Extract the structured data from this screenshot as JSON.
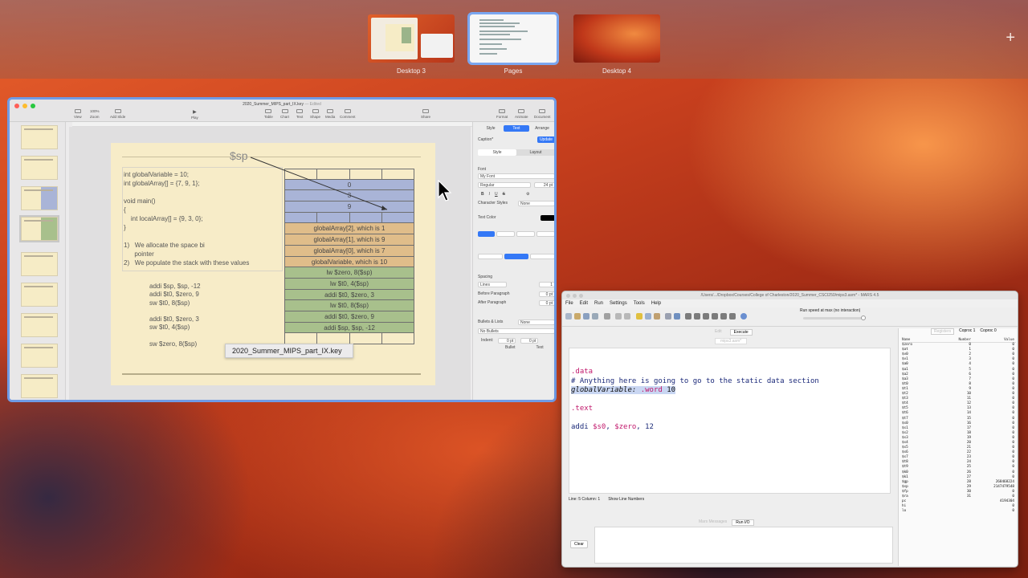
{
  "mission_control": {
    "spaces": [
      {
        "label": "Desktop 3",
        "active": false
      },
      {
        "label": "Pages",
        "active": true
      },
      {
        "label": "Desktop 4",
        "active": false
      }
    ],
    "add_space_icon": "plus-icon"
  },
  "keynote": {
    "title": "2020_Summer_MIPS_part_IX.key",
    "title_suffix": "— Edited",
    "toolbar": [
      "View",
      "Zoom",
      "Add Slide",
      "Play",
      "Table",
      "Chart",
      "Text",
      "Shape",
      "Media",
      "Comment",
      "Share",
      "Format",
      "Animate",
      "Document"
    ],
    "zoom": "100%",
    "tooltip": "2020_Summer_MIPS_part_IX.key",
    "slide": {
      "sp_label": "$sp",
      "code": "int globalVariable = 10;\nint globalArray[] = {7, 9, 1};\n\nvoid main()\n{\n    int localArray[] = {9, 3, 0};\n}",
      "bullets": "1)   We allocate the space bi\n      pointer\n2)   We populate the stack with these values",
      "mips": "addi $sp, $sp, -12\naddi $t0, $zero, 9\nsw $t0, 8($sp)\n\naddi $t0, $zero, 3\nsw $t0, 4($sp)\n\nsw $zero, 8($sp)",
      "stack_rows": [
        {
          "text": "",
          "color": "empty",
          "cells": true
        },
        {
          "text": "0",
          "color": "blue"
        },
        {
          "text": "3",
          "color": "blue"
        },
        {
          "text": "9",
          "color": "blue"
        },
        {
          "text": "",
          "color": "blue",
          "cells": true
        },
        {
          "text": "globalArray[2], which is 1",
          "color": "tan"
        },
        {
          "text": "globalArray[1], which is 9",
          "color": "tan"
        },
        {
          "text": "globalArray[0], which is 7",
          "color": "tan"
        },
        {
          "text": "globalVariable, which is 10",
          "color": "tan"
        },
        {
          "text": "lw $zero, 8($sp)",
          "color": "green"
        },
        {
          "text": "lw $t0, 4($sp)",
          "color": "green"
        },
        {
          "text": "addi $t0, $zero, 3",
          "color": "green"
        },
        {
          "text": "lw $t0, 8($sp)",
          "color": "green"
        },
        {
          "text": "addi $t0, $zero, 9",
          "color": "green"
        },
        {
          "text": "addi $sp, $sp, -12",
          "color": "green"
        },
        {
          "text": "",
          "color": "empty",
          "cells": true
        }
      ]
    },
    "inspector": {
      "tabs": [
        "Style",
        "Text",
        "Arrange"
      ],
      "active_tab": "Text",
      "paragraph_style": "Caption*",
      "update_label": "Update",
      "subtabs": [
        "Style",
        "Layout"
      ],
      "font_label": "Font",
      "font_name": "My Font",
      "font_weight": "Regular",
      "font_size": "24 pt",
      "char_styles_label": "Character Styles",
      "char_styles_value": "None",
      "text_color_label": "Text Color",
      "spacing_label": "Spacing",
      "spacing_value": "Lines",
      "spacing_num": "1",
      "before_para_label": "Before Paragraph",
      "before_para_value": "0 pt",
      "after_para_label": "After Paragraph",
      "after_para_value": "0 pt",
      "bullets_label": "Bullets & Lists",
      "bullets_value": "None",
      "no_bullets": "No Bullets",
      "indent_label": "Indent:",
      "indent_bullet": "Bullet",
      "indent_text": "Text"
    },
    "colors": {
      "border": "#6f9be6"
    }
  },
  "mars": {
    "title": "/Users/.../Dropbox/Courses/College of Charleston/2020_Summer_CSCI250/mips3.asm* - MARS 4.5",
    "menu": [
      "File",
      "Edit",
      "Run",
      "Settings",
      "Tools",
      "Help"
    ],
    "speed_label": "Run speed at max (no interaction)",
    "edit_tabs": [
      "Edit",
      "Execute"
    ],
    "active_edit_tab": "Execute",
    "file_tab": "mips3.asm*",
    "code_lines": [
      {
        "parts": [
          {
            "t": ".data",
            "c": "asm-dir"
          }
        ]
      },
      {
        "parts": [
          {
            "t": "# Anything here is going to go to the static data section",
            "c": "asm-cmt"
          }
        ]
      },
      {
        "parts": [
          {
            "t": "globalVariable:",
            "c": "asm-lbl"
          },
          {
            "t": " .word",
            "c": "asm-dir asm-lblhl"
          },
          {
            "t": " 10",
            "c": "asm-num asm-lblhl"
          }
        ]
      },
      {
        "parts": [
          {
            "t": " ",
            "c": ""
          }
        ]
      },
      {
        "parts": [
          {
            "t": ".text",
            "c": "asm-dir"
          }
        ]
      },
      {
        "parts": [
          {
            "t": " ",
            "c": ""
          }
        ]
      },
      {
        "parts": [
          {
            "t": "addi ",
            "c": "asm-ins"
          },
          {
            "t": "$s0",
            "c": "asm-reg"
          },
          {
            "t": ", ",
            "c": "asm-ins"
          },
          {
            "t": "$zero",
            "c": "asm-reg"
          },
          {
            "t": ", 12",
            "c": "asm-ins"
          }
        ]
      }
    ],
    "status_line": "Line: 5 Column: 1",
    "show_line_numbers": "Show Line Numbers",
    "io_tabs": [
      "Mars Messages",
      "Run I/O"
    ],
    "active_io_tab": "Run I/O",
    "clear_label": "Clear",
    "reg_tabs": [
      "Registers",
      "Coproc 1",
      "Coproc 0"
    ],
    "reg_header": [
      "Name",
      "Number",
      "Value"
    ],
    "registers": [
      [
        "$zero",
        "0",
        "0"
      ],
      [
        "$at",
        "1",
        "0"
      ],
      [
        "$v0",
        "2",
        "0"
      ],
      [
        "$v1",
        "3",
        "0"
      ],
      [
        "$a0",
        "4",
        "0"
      ],
      [
        "$a1",
        "5",
        "0"
      ],
      [
        "$a2",
        "6",
        "0"
      ],
      [
        "$a3",
        "7",
        "0"
      ],
      [
        "$t0",
        "8",
        "0"
      ],
      [
        "$t1",
        "9",
        "0"
      ],
      [
        "$t2",
        "10",
        "0"
      ],
      [
        "$t3",
        "11",
        "0"
      ],
      [
        "$t4",
        "12",
        "0"
      ],
      [
        "$t5",
        "13",
        "0"
      ],
      [
        "$t6",
        "14",
        "0"
      ],
      [
        "$t7",
        "15",
        "0"
      ],
      [
        "$s0",
        "16",
        "0"
      ],
      [
        "$s1",
        "17",
        "0"
      ],
      [
        "$s2",
        "18",
        "0"
      ],
      [
        "$s3",
        "19",
        "0"
      ],
      [
        "$s4",
        "20",
        "0"
      ],
      [
        "$s5",
        "21",
        "0"
      ],
      [
        "$s6",
        "22",
        "0"
      ],
      [
        "$s7",
        "23",
        "0"
      ],
      [
        "$t8",
        "24",
        "0"
      ],
      [
        "$t9",
        "25",
        "0"
      ],
      [
        "$k0",
        "26",
        "0"
      ],
      [
        "$k1",
        "27",
        "0"
      ],
      [
        "$gp",
        "28",
        "268468224"
      ],
      [
        "$sp",
        "29",
        "2147479548"
      ],
      [
        "$fp",
        "30",
        "0"
      ],
      [
        "$ra",
        "31",
        "0"
      ],
      [
        "pc",
        "",
        "4194304"
      ],
      [
        "hi",
        "",
        "0"
      ],
      [
        "lo",
        "",
        "0"
      ]
    ]
  }
}
